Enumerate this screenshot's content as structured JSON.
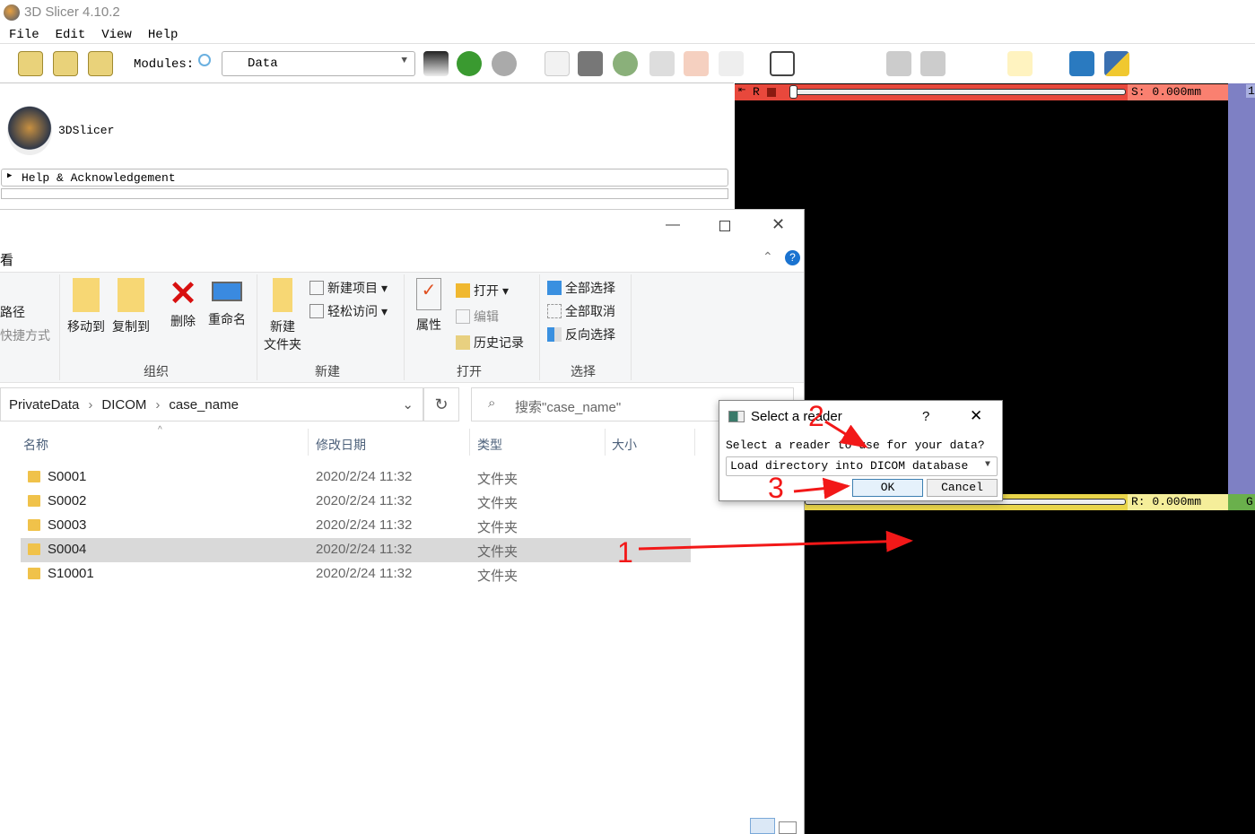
{
  "app": {
    "title": "3D Slicer 4.10.2",
    "menu": [
      "File",
      "Edit",
      "View",
      "Help"
    ],
    "toolbar": {
      "modules_label": "Modules:",
      "module_selected": "Data",
      "icons": [
        "load-data-icon",
        "load-dicom-icon",
        "save-icon",
        "search-icon",
        "layout-icon",
        "back-icon",
        "forward-icon"
      ]
    },
    "module_panel": {
      "logo_text": "3DSlicer",
      "help_section": "Help & Acknowledgement"
    },
    "red_slice": {
      "label": "R",
      "offset": "S: 0.000mm",
      "color": "#e8483c"
    },
    "yellow_slice": {
      "offset": "R: 0.000mm",
      "color": "#efe37a"
    },
    "green_slice": {
      "label": "G",
      "color": "#6ab04c"
    },
    "blue_label": "1"
  },
  "explorer": {
    "tab_partial": "看",
    "ribbon": {
      "left_partial": [
        "路径",
        "快捷方式"
      ],
      "organize": {
        "move_to": "移动到",
        "copy_to": "复制到",
        "delete": "删除",
        "rename": "重命名",
        "group": "组织"
      },
      "new": {
        "new_folder_1": "新建",
        "new_folder_2": "文件夹",
        "new_item": "新建项目",
        "easy_access": "轻松访问",
        "group": "新建"
      },
      "open": {
        "properties": "属性",
        "open": "打开",
        "edit": "编辑",
        "history": "历史记录",
        "group": "打开"
      },
      "select": {
        "select_all": "全部选择",
        "select_none": "全部取消",
        "invert": "反向选择",
        "group": "选择"
      }
    },
    "breadcrumb": [
      "PrivateData",
      "DICOM",
      "case_name"
    ],
    "search_placeholder": "搜索\"case_name\"",
    "columns": [
      "名称",
      "修改日期",
      "类型",
      "大小"
    ],
    "rows": [
      {
        "name": "S0001",
        "date": "2020/2/24 11:32",
        "type": "文件夹",
        "selected": false
      },
      {
        "name": "S0002",
        "date": "2020/2/24 11:32",
        "type": "文件夹",
        "selected": false
      },
      {
        "name": "S0003",
        "date": "2020/2/24 11:32",
        "type": "文件夹",
        "selected": false
      },
      {
        "name": "S0004",
        "date": "2020/2/24 11:32",
        "type": "文件夹",
        "selected": true
      },
      {
        "name": "S10001",
        "date": "2020/2/24 11:32",
        "type": "文件夹",
        "selected": false
      }
    ]
  },
  "dialog": {
    "title": "Select a reader",
    "help": "?",
    "prompt": "Select a reader to use for your data?",
    "reader_selected": "Load directory into DICOM database",
    "ok": "OK",
    "cancel": "Cancel"
  },
  "annotations": [
    "1",
    "2",
    "3"
  ]
}
